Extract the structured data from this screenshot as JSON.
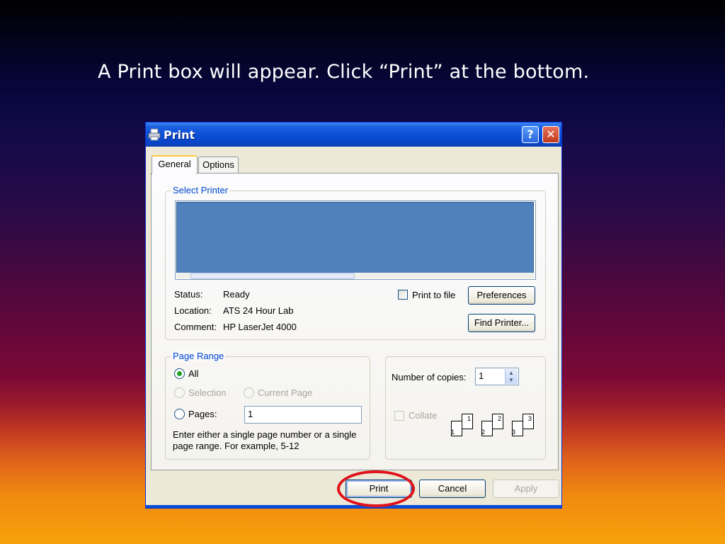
{
  "caption": "A Print box will appear. Click “Print” at the bottom.",
  "dialog": {
    "title": "Print",
    "help_btn": "?",
    "close_btn": "✕",
    "tabs": [
      "General",
      "Options"
    ],
    "select_printer": {
      "legend": "Select Printer",
      "status_label": "Status:",
      "status_value": "Ready",
      "location_label": "Location:",
      "location_value": "ATS 24 Hour Lab",
      "comment_label": "Comment:",
      "comment_value": "HP LaserJet 4000",
      "print_to_file": "Print to file",
      "preferences": "Preferences",
      "find_printer": "Find Printer..."
    },
    "page_range": {
      "legend": "Page Range",
      "all": "All",
      "selection": "Selection",
      "current_page": "Current Page",
      "pages": "Pages:",
      "pages_value": "1",
      "help_line1": "Enter either a single page number or a single",
      "help_line2": "page range.  For example, 5-12"
    },
    "copies": {
      "label": "Number of copies:",
      "value": "1",
      "collate": "Collate",
      "page_numbers": [
        "1",
        "1",
        "2",
        "2",
        "3",
        "3"
      ]
    },
    "buttons": {
      "print": "Print",
      "cancel": "Cancel",
      "apply": "Apply"
    }
  },
  "colors": {
    "titlebar": "#0a4fd6",
    "legend": "#0046d5",
    "highlight_ring": "#e0121a",
    "redaction": "#4f81bd"
  }
}
